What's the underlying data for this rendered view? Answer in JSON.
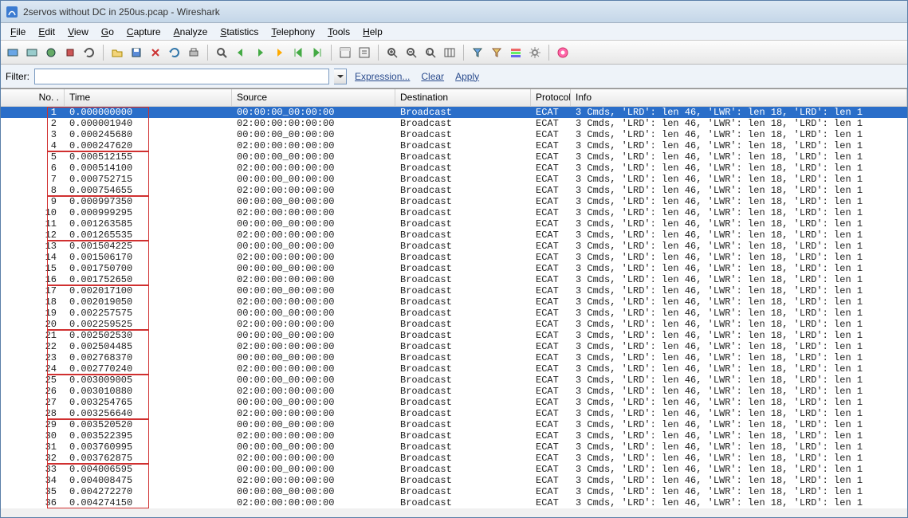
{
  "window": {
    "title": "2servos without DC in 250us.pcap - Wireshark"
  },
  "menu": [
    "File",
    "Edit",
    "View",
    "Go",
    "Capture",
    "Analyze",
    "Statistics",
    "Telephony",
    "Tools",
    "Help"
  ],
  "filter": {
    "label": "Filter:",
    "value": "",
    "placeholder": "",
    "expression": "Expression...",
    "clear": "Clear",
    "apply": "Apply"
  },
  "columns": {
    "no": "No. .",
    "time": "Time",
    "source": "Source",
    "destination": "Destination",
    "protocol": "Protocol",
    "info": "Info"
  },
  "info_selected": "3 Cmds, 'LRD': len 46, 'LWR': len 18, 'LRD': len 1",
  "info_default": "3 Cmds, 'LRD': len 46, 'LWR': len 18, 'LRD': len 1",
  "rows": [
    {
      "no": 1,
      "time": "0.000000000",
      "src": "00:00:00_00:00:00",
      "dst": "Broadcast",
      "proto": "ECAT",
      "sel": true
    },
    {
      "no": 2,
      "time": "0.000001940",
      "src": "02:00:00:00:00:00",
      "dst": "Broadcast",
      "proto": "ECAT"
    },
    {
      "no": 3,
      "time": "0.000245680",
      "src": "00:00:00_00:00:00",
      "dst": "Broadcast",
      "proto": "ECAT"
    },
    {
      "no": 4,
      "time": "0.000247620",
      "src": "02:00:00:00:00:00",
      "dst": "Broadcast",
      "proto": "ECAT"
    },
    {
      "no": 5,
      "time": "0.000512155",
      "src": "00:00:00_00:00:00",
      "dst": "Broadcast",
      "proto": "ECAT"
    },
    {
      "no": 6,
      "time": "0.000514100",
      "src": "02:00:00:00:00:00",
      "dst": "Broadcast",
      "proto": "ECAT"
    },
    {
      "no": 7,
      "time": "0.000752715",
      "src": "00:00:00_00:00:00",
      "dst": "Broadcast",
      "proto": "ECAT"
    },
    {
      "no": 8,
      "time": "0.000754655",
      "src": "02:00:00:00:00:00",
      "dst": "Broadcast",
      "proto": "ECAT"
    },
    {
      "no": 9,
      "time": "0.000997350",
      "src": "00:00:00_00:00:00",
      "dst": "Broadcast",
      "proto": "ECAT"
    },
    {
      "no": 10,
      "time": "0.000999295",
      "src": "02:00:00:00:00:00",
      "dst": "Broadcast",
      "proto": "ECAT"
    },
    {
      "no": 11,
      "time": "0.001263585",
      "src": "00:00:00_00:00:00",
      "dst": "Broadcast",
      "proto": "ECAT"
    },
    {
      "no": 12,
      "time": "0.001265535",
      "src": "02:00:00:00:00:00",
      "dst": "Broadcast",
      "proto": "ECAT"
    },
    {
      "no": 13,
      "time": "0.001504225",
      "src": "00:00:00_00:00:00",
      "dst": "Broadcast",
      "proto": "ECAT"
    },
    {
      "no": 14,
      "time": "0.001506170",
      "src": "02:00:00:00:00:00",
      "dst": "Broadcast",
      "proto": "ECAT"
    },
    {
      "no": 15,
      "time": "0.001750700",
      "src": "00:00:00_00:00:00",
      "dst": "Broadcast",
      "proto": "ECAT"
    },
    {
      "no": 16,
      "time": "0.001752650",
      "src": "02:00:00:00:00:00",
      "dst": "Broadcast",
      "proto": "ECAT"
    },
    {
      "no": 17,
      "time": "0.002017100",
      "src": "00:00:00_00:00:00",
      "dst": "Broadcast",
      "proto": "ECAT"
    },
    {
      "no": 18,
      "time": "0.002019050",
      "src": "02:00:00:00:00:00",
      "dst": "Broadcast",
      "proto": "ECAT"
    },
    {
      "no": 19,
      "time": "0.002257575",
      "src": "00:00:00_00:00:00",
      "dst": "Broadcast",
      "proto": "ECAT"
    },
    {
      "no": 20,
      "time": "0.002259525",
      "src": "02:00:00:00:00:00",
      "dst": "Broadcast",
      "proto": "ECAT"
    },
    {
      "no": 21,
      "time": "0.002502530",
      "src": "00:00:00_00:00:00",
      "dst": "Broadcast",
      "proto": "ECAT"
    },
    {
      "no": 22,
      "time": "0.002504485",
      "src": "02:00:00:00:00:00",
      "dst": "Broadcast",
      "proto": "ECAT"
    },
    {
      "no": 23,
      "time": "0.002768370",
      "src": "00:00:00_00:00:00",
      "dst": "Broadcast",
      "proto": "ECAT"
    },
    {
      "no": 24,
      "time": "0.002770240",
      "src": "02:00:00:00:00:00",
      "dst": "Broadcast",
      "proto": "ECAT"
    },
    {
      "no": 25,
      "time": "0.003009005",
      "src": "00:00:00_00:00:00",
      "dst": "Broadcast",
      "proto": "ECAT"
    },
    {
      "no": 26,
      "time": "0.003010880",
      "src": "02:00:00:00:00:00",
      "dst": "Broadcast",
      "proto": "ECAT"
    },
    {
      "no": 27,
      "time": "0.003254765",
      "src": "00:00:00_00:00:00",
      "dst": "Broadcast",
      "proto": "ECAT"
    },
    {
      "no": 28,
      "time": "0.003256640",
      "src": "02:00:00:00:00:00",
      "dst": "Broadcast",
      "proto": "ECAT"
    },
    {
      "no": 29,
      "time": "0.003520520",
      "src": "00:00:00_00:00:00",
      "dst": "Broadcast",
      "proto": "ECAT"
    },
    {
      "no": 30,
      "time": "0.003522395",
      "src": "02:00:00:00:00:00",
      "dst": "Broadcast",
      "proto": "ECAT"
    },
    {
      "no": 31,
      "time": "0.003760995",
      "src": "00:00:00_00:00:00",
      "dst": "Broadcast",
      "proto": "ECAT"
    },
    {
      "no": 32,
      "time": "0.003762875",
      "src": "02:00:00:00:00:00",
      "dst": "Broadcast",
      "proto": "ECAT"
    },
    {
      "no": 33,
      "time": "0.004006595",
      "src": "00:00:00_00:00:00",
      "dst": "Broadcast",
      "proto": "ECAT"
    },
    {
      "no": 34,
      "time": "0.004008475",
      "src": "02:00:00:00:00:00",
      "dst": "Broadcast",
      "proto": "ECAT"
    },
    {
      "no": 35,
      "time": "0.004272270",
      "src": "00:00:00_00:00:00",
      "dst": "Broadcast",
      "proto": "ECAT"
    },
    {
      "no": 36,
      "time": "0.004274150",
      "src": "02:00:00:00:00:00",
      "dst": "Broadcast",
      "proto": "ECAT"
    }
  ],
  "highlight_groups": [
    {
      "start": 1,
      "end": 4
    },
    {
      "start": 5,
      "end": 8
    },
    {
      "start": 9,
      "end": 12
    },
    {
      "start": 13,
      "end": 16
    },
    {
      "start": 17,
      "end": 20
    },
    {
      "start": 21,
      "end": 24
    },
    {
      "start": 25,
      "end": 28
    },
    {
      "start": 29,
      "end": 32
    },
    {
      "start": 33,
      "end": 36
    }
  ]
}
